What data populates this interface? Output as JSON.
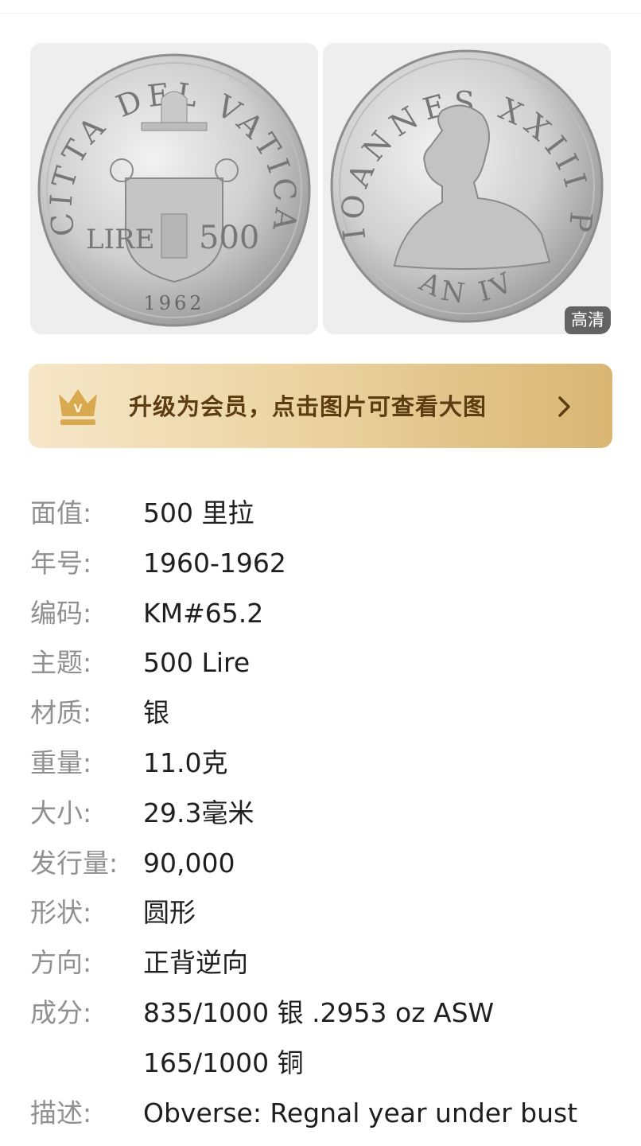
{
  "images": {
    "obverse": {
      "legend": "CITTA DEL VATICANO",
      "left_text": "LIRE",
      "right_text": "500",
      "year": "1962"
    },
    "reverse": {
      "legend": "IOANNES XXIII P M",
      "bottom_text": "AN IV"
    },
    "hd_badge": "高清"
  },
  "member_banner": {
    "text": "升级为会员，点击图片可查看大图",
    "icon": "crown-icon",
    "icon_letter": "V",
    "chevron": "chevron-right-icon"
  },
  "colors": {
    "banner_text": "#5c3d12",
    "label": "#909090",
    "value": "#1f1f1f"
  },
  "info": [
    {
      "label": "面值:",
      "value": "500 里拉"
    },
    {
      "label": "年号:",
      "value": "1960-1962"
    },
    {
      "label": "编码:",
      "value": "KM#65.2"
    },
    {
      "label": "主题:",
      "value": "500 Lire"
    },
    {
      "label": "材质:",
      "value": "银"
    },
    {
      "label": "重量:",
      "value": "11.0克"
    },
    {
      "label": "大小:",
      "value": "29.3毫米"
    },
    {
      "label": "发行量:",
      "value": "90,000"
    },
    {
      "label": "形状:",
      "value": "圆形"
    },
    {
      "label": "方向:",
      "value": "正背逆向"
    },
    {
      "label": "成分:",
      "value": "835/1000 银 .2953 oz ASW"
    },
    {
      "label": "",
      "value": "165/1000 铜"
    },
    {
      "label": "描述:",
      "value": "Obverse: Regnal year under bust"
    }
  ]
}
